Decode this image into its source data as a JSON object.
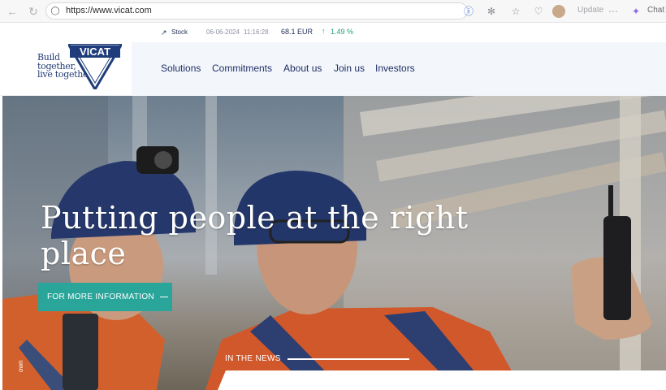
{
  "browser": {
    "url": "https://www.vicat.com",
    "update_label": "Update",
    "chat_label": "Chat"
  },
  "stock": {
    "label": "Stock",
    "date": "06-06-2024",
    "time": "11:16:28",
    "price": "68.1 EUR",
    "change": "1.49 %"
  },
  "brand": {
    "name": "VICAT",
    "tagline_lines": [
      "Build",
      "together,",
      "live together"
    ]
  },
  "nav": {
    "items": [
      "Solutions",
      "Commitments",
      "About us",
      "Join us",
      "Investors"
    ]
  },
  "hero": {
    "title": "Putting people at the right place",
    "cta_label": "FOR MORE INFORMATION",
    "news_label": "IN THE NEWS",
    "scroll_label": "own"
  },
  "colors": {
    "brand_blue": "#1f2f66",
    "cta_teal": "#2aa59a",
    "stock_up_green": "#1fa079"
  }
}
